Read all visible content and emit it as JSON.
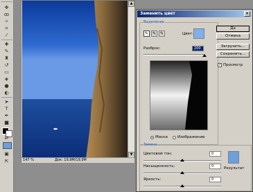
{
  "colors": {
    "app_bg": "#8e8e8e",
    "panel": "#d4d0c8",
    "sample_color": "#7fb0ec",
    "result_color": "#6a9fe0",
    "group_label": "#1a50a8"
  },
  "toolbox": {
    "tools": [
      "move-icon",
      "lasso-icon",
      "magic-wand-icon",
      "crop-icon",
      "slice-icon",
      "healing-brush-icon",
      "brush-icon",
      "clone-stamp-icon",
      "history-brush-icon",
      "eraser-icon",
      "paint-bucket-icon",
      "blur-icon",
      "dodge-icon",
      "path-selection-icon",
      "type-icon",
      "pen-icon",
      "shape-icon",
      "notes-icon",
      "eyedropper-icon",
      "hand-icon",
      "zoom-icon"
    ]
  },
  "document": {
    "zoom": "147 %",
    "doc_info": "Док: 19,9M/19,9M"
  },
  "dialog": {
    "title": "Заменить цвет",
    "selection_group": "Выделение",
    "color_label": "Цвет:",
    "fuzziness_label": "Разброс:",
    "fuzziness_value": "200",
    "fuzziness_level": 1.0,
    "mask_label": "Маска",
    "image_label": "Изображение",
    "view_mode": "mask",
    "buttons": {
      "ok": "Да",
      "cancel": "Отмена",
      "load": "Загрузить...",
      "save": "Сохранить..."
    },
    "preview_label": "Просмотр",
    "preview_checked": true,
    "replace_group": "Замена",
    "hue_label": "Цветовой тон:",
    "hue_value": "0",
    "saturation_label": "Насыщенность:",
    "saturation_value": "0",
    "lightness_label": "Яркость:",
    "lightness_value": "0",
    "result_label": "Результат"
  }
}
